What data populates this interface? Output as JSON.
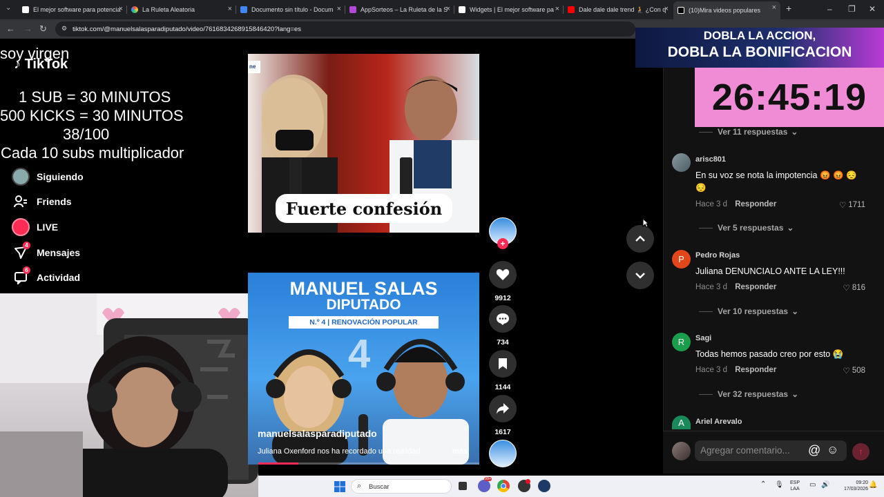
{
  "browser": {
    "tabs": [
      {
        "label": "El mejor software para potencia"
      },
      {
        "label": "La Ruleta Aleatoria"
      },
      {
        "label": "Documento sin título - Docum"
      },
      {
        "label": "AppSorteos – La Ruleta de la S"
      },
      {
        "label": "Widgets | El mejor software pa"
      },
      {
        "label": "Dale dale dale trend 🧎 ¿Con q"
      },
      {
        "label": "(10)Mira videos populares"
      }
    ],
    "url": "tiktok.com/@manuelsalasparadiputado/video/7616834268915846420?lang=es"
  },
  "overlay": {
    "line_top": "soy virgen",
    "line1": "1 SUB      = 30 MINUTOS",
    "line2": "500 KICKS = 30 MINUTOS",
    "line3": "38/100",
    "line4": "Cada 10 subs multiplicador"
  },
  "tiktok": {
    "logo": "TikTok",
    "nav": [
      {
        "label": "Siguiendo",
        "icon": "avatar-icon"
      },
      {
        "label": "Friends",
        "icon": "friends-icon"
      },
      {
        "label": "LIVE",
        "icon": "live-icon"
      },
      {
        "label": "Mensajes",
        "icon": "messages-icon",
        "badge": "4"
      },
      {
        "label": "Actividad",
        "icon": "activity-icon",
        "badge": "6"
      }
    ]
  },
  "video1": {
    "caption": "Fuerte confesión",
    "tag": "ne"
  },
  "video2": {
    "title": "MANUEL SALAS",
    "subtitle": "DIPUTADO",
    "band": "N.º 4 | RENOVACIÓN POPULAR",
    "number": "4",
    "username": "manuelsalasparadiputado",
    "description": "Juliana Oxenford nos ha recordado una realidad",
    "more": "más",
    "progress": 0.18
  },
  "actions": {
    "likes": "9912",
    "comments": "734",
    "saves": "1144",
    "shares": "1617"
  },
  "promo": {
    "line1": "DOBLA LA ACCION,",
    "line2": "DOBLA LA BONIFICACION",
    "timer": "26:45:19"
  },
  "comments": {
    "first_replies": "Ver 11 respuestas",
    "items": [
      {
        "user": "arisc801",
        "text": "En su voz se nota la impotencia 😡 😡 😔 😔",
        "time": "Hace 3 d",
        "reply": "Responder",
        "likes": "1711",
        "replies": "Ver 5 respuestas",
        "avatar_color": "#6b7c86"
      },
      {
        "user": "Pedro Rojas",
        "text": "Juliana DENUNCIALO ANTE LA LEY!!!",
        "time": "Hace 3 d",
        "reply": "Responder",
        "likes": "816",
        "replies": "Ver 10 respuestas",
        "avatar_letter": "P",
        "avatar_color": "#e2471c"
      },
      {
        "user": "Sagi",
        "text": "Todas hemos pasado creo por esto 😭",
        "time": "Hace 3 d",
        "reply": "Responder",
        "likes": "508",
        "replies": "Ver 32 respuestas",
        "avatar_letter": "R",
        "avatar_color": "#1b9e4c"
      },
      {
        "user": "Ariel Arevalo",
        "avatar_letter": "A",
        "avatar_color": "#1a8a5a"
      }
    ],
    "input_placeholder": "Agregar comentario..."
  },
  "taskbar": {
    "search": "Buscar",
    "lang1": "ESP",
    "lang2": "LAA",
    "time": "09:20",
    "date": "17/03/2026",
    "chat_badge": "99+"
  }
}
